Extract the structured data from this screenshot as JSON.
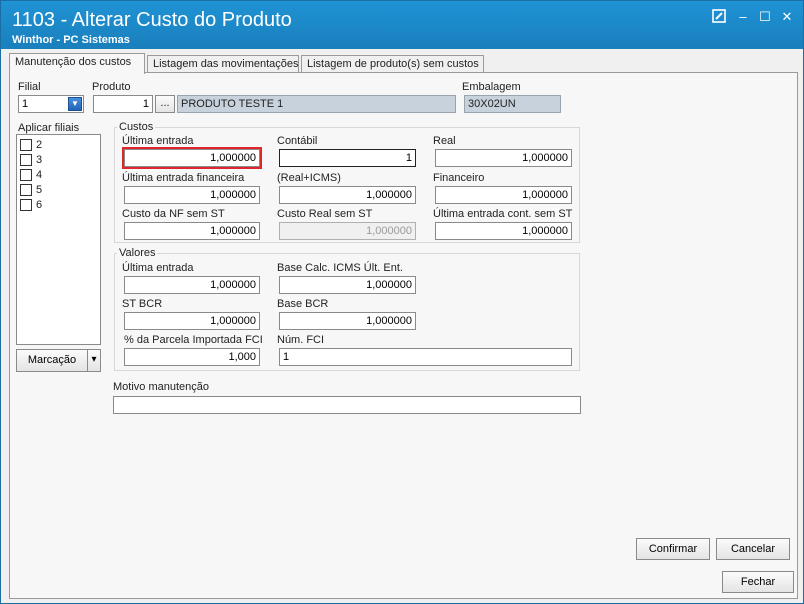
{
  "window": {
    "title": "1103 - Alterar Custo do Produto",
    "subtitle": "Winthor - PC Sistemas",
    "controls": {
      "restore_icon": "pencil-square",
      "minimize_label": "–",
      "maximize_label": "☐",
      "close_label": "✕"
    }
  },
  "tabs": [
    {
      "label": "Manutenção dos custos",
      "active": true
    },
    {
      "label": "Listagem das movimentações",
      "active": false
    },
    {
      "label": "Listagem de produto(s)  sem custos",
      "active": false
    }
  ],
  "header": {
    "filial_label": "Filial",
    "filial_value": "1",
    "produto_label": "Produto",
    "produto_code": "1",
    "browse_label": "...",
    "produto_desc": "PRODUTO TESTE 1",
    "embalagem_label": "Embalagem",
    "embalagem_value": "30X02UN"
  },
  "aplicar_filiais": {
    "label": "Aplicar filiais",
    "items": [
      "2",
      "3",
      "4",
      "5",
      "6"
    ],
    "marcacao_label": "Marcação",
    "dropdown_glyph": "▾"
  },
  "custos": {
    "title": "Custos",
    "ultima_entrada_label": "Última entrada",
    "ultima_entrada_value": "1,000000",
    "contabil_label": "Contábil",
    "contabil_value": "1",
    "real_label": "Real",
    "real_value": "1,000000",
    "ult_ent_fin_label": "Última entrada financeira",
    "ult_ent_fin_value": "1,000000",
    "real_icms_label": "(Real+ICMS)",
    "real_icms_value": "1,000000",
    "financeiro_label": "Financeiro",
    "financeiro_value": "1,000000",
    "custo_nf_label": "Custo da NF sem ST",
    "custo_nf_value": "1,000000",
    "custo_real_st_label": "Custo Real sem ST",
    "custo_real_st_value": "1,000000",
    "ult_ent_cont_label": "Última entrada cont. sem ST",
    "ult_ent_cont_value": "1,000000"
  },
  "valores": {
    "title": "Valores",
    "ultima_entrada_label": "Última entrada",
    "ultima_entrada_value": "1,000000",
    "base_icms_label": "Base Calc. ICMS Últ. Ent.",
    "base_icms_value": "1,000000",
    "st_bcr_label": "ST BCR",
    "st_bcr_value": "1,000000",
    "base_bcr_label": "Base BCR",
    "base_bcr_value": "1,000000",
    "parcela_label": "% da Parcela Importada FCI",
    "parcela_value": "1,000",
    "num_fci_label": "Núm. FCI",
    "num_fci_value": "1"
  },
  "motivo": {
    "label": "Motivo manutenção",
    "value": ""
  },
  "buttons": {
    "confirmar": "Confirmar",
    "cancelar": "Cancelar",
    "fechar": "Fechar"
  },
  "colors": {
    "titlebar": "#1a7fbd",
    "highlight": "#e0262b",
    "readonly_field": "#c8d2dc"
  }
}
